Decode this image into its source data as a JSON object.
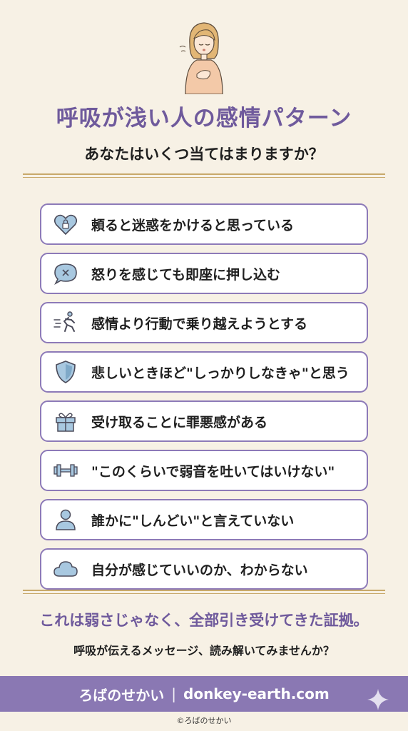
{
  "title": "呼吸が浅い人の感情パターン",
  "subtitle": "あなたはいくつ当てはまりますか？",
  "items": [
    {
      "text": "頼ると迷惑をかけると思っている",
      "icon": "heart-lock-icon"
    },
    {
      "text": "怒りを感じても即座に押し込む",
      "icon": "speech-bubble-x-icon"
    },
    {
      "text": "感情より行動で乗り越えようとする",
      "icon": "running-person-icon"
    },
    {
      "text": "悲しいときほど\"しっかりしなきゃ\"と思う",
      "icon": "shield-icon"
    },
    {
      "text": "受け取ることに罪悪感がある",
      "icon": "gift-icon"
    },
    {
      "text": "\"このくらいで弱音を吐いてはいけない\"",
      "icon": "dumbbell-icon"
    },
    {
      "text": "誰かに\"しんどい\"と言えていない",
      "icon": "person-icon"
    },
    {
      "text": "自分が感じていいのか、わからない",
      "icon": "cloud-icon"
    }
  ],
  "conclusion": "これは弱さじゃなく、全部引き受けてきた証拠。",
  "cta": "呼吸が伝えるメッセージ、読み解いてみませんか？",
  "footer": {
    "brand": "ろばのせかい",
    "separator": "|",
    "site": "donkey-earth.com"
  },
  "copyright": "©ろばのせかい",
  "colors": {
    "background": "#f7f1e5",
    "accent": "#6f5a9c",
    "band": "#8a78b3",
    "gold": "#c8a96a",
    "icon_fill": "#a8c8e0"
  }
}
